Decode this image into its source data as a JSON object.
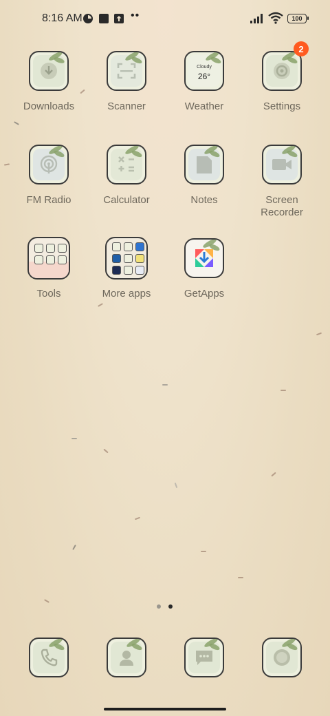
{
  "status_bar": {
    "time": "8:16 AM",
    "battery": "100",
    "icons": [
      "photo-icon",
      "square-icon",
      "upload-icon",
      "more-dots-icon",
      "signal-icon",
      "wifi-icon",
      "battery-icon"
    ]
  },
  "apps_row1": [
    {
      "label": "Downloads",
      "icon": "download-icon"
    },
    {
      "label": "Scanner",
      "icon": "scanner-icon"
    },
    {
      "label": "Weather",
      "icon": "weather-icon",
      "widget_condition": "Cloudy",
      "widget_temp": "26°"
    },
    {
      "label": "Settings",
      "icon": "gear-icon",
      "badge": "2"
    }
  ],
  "apps_row2": [
    {
      "label": "FM Radio",
      "icon": "radio-icon"
    },
    {
      "label": "Calculator",
      "icon": "calculator-icon"
    },
    {
      "label": "Notes",
      "icon": "notes-icon"
    },
    {
      "label": "Screen Recorder",
      "label_line1": "Screen",
      "label_line2": "Recorder",
      "icon": "video-camera-icon"
    }
  ],
  "apps_row3": [
    {
      "label": "Tools",
      "icon": "folder-icon"
    },
    {
      "label": "More apps",
      "icon": "folder-icon"
    },
    {
      "label": "GetApps",
      "icon": "getapps-icon"
    }
  ],
  "page_indicator": {
    "pages": 2,
    "current": 2
  },
  "dock": [
    {
      "name": "phone",
      "icon": "phone-icon"
    },
    {
      "name": "contacts",
      "icon": "contacts-icon"
    },
    {
      "name": "messages",
      "icon": "message-icon"
    },
    {
      "name": "camera",
      "icon": "camera-icon"
    }
  ],
  "colors": {
    "badge": "#ff5a1f",
    "icon_bg": "#eef0df",
    "leaf": "#8aa26b",
    "wallpaper": "#ebdcc2"
  }
}
